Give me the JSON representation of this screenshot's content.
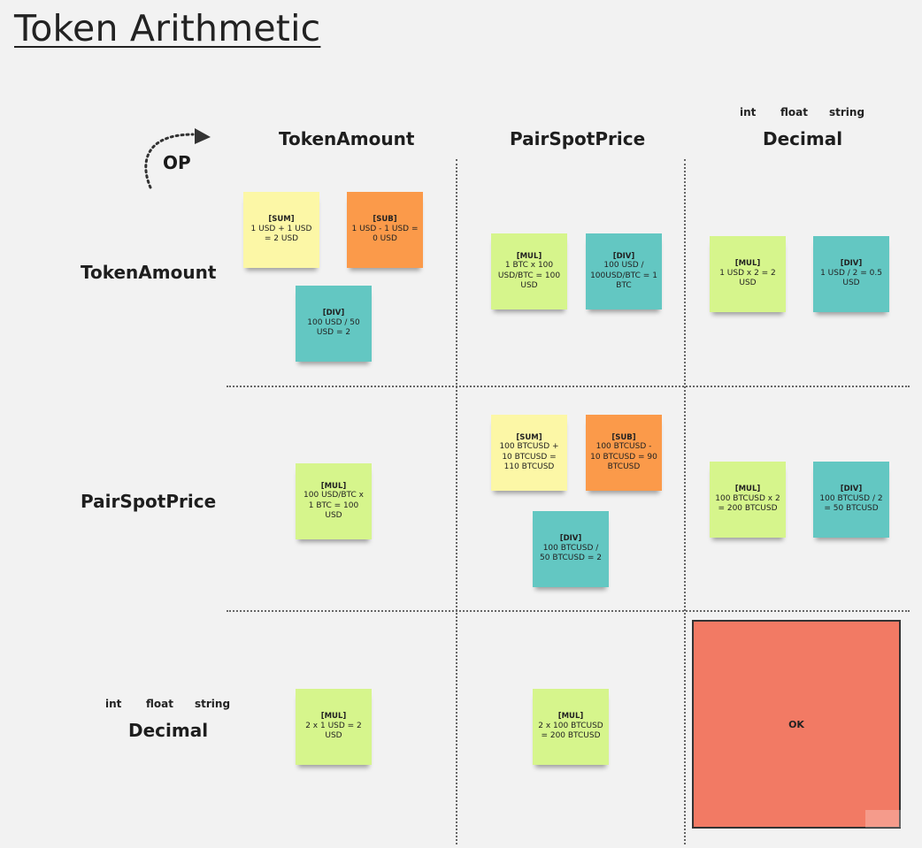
{
  "title": "Token Arithmetic",
  "op_label": "OP",
  "columns": {
    "token_amount": "TokenAmount",
    "pair_spot_price": "PairSpotPrice",
    "decimal": "Decimal",
    "decimal_types": [
      "int",
      "float",
      "string"
    ]
  },
  "rows": {
    "token_amount": "TokenAmount",
    "pair_spot_price": "PairSpotPrice",
    "decimal": "Decimal",
    "decimal_types": [
      "int",
      "float",
      "string"
    ]
  },
  "notes": {
    "ta_ta": [
      {
        "op": "[SUM]",
        "expr": "1 USD + 1 USD = 2 USD",
        "color": "#fcf7a6"
      },
      {
        "op": "[SUB]",
        "expr": "1 USD - 1 USD = 0 USD",
        "color": "#fb9a4a"
      },
      {
        "op": "[DIV]",
        "expr": "100 USD / 50 USD = 2",
        "color": "#63c7c2"
      }
    ],
    "ta_psp": [
      {
        "op": "[MUL]",
        "expr": "1 BTC x 100 USD/BTC = 100 USD",
        "color": "#d6f58c"
      },
      {
        "op": "[DIV]",
        "expr": "100 USD / 100USD/BTC = 1 BTC",
        "color": "#63c7c2"
      }
    ],
    "ta_dec": [
      {
        "op": "[MUL]",
        "expr": "1 USD x 2 = 2 USD",
        "color": "#d6f58c"
      },
      {
        "op": "[DIV]",
        "expr": "1 USD / 2 = 0.5 USD",
        "color": "#63c7c2"
      }
    ],
    "psp_ta": [
      {
        "op": "[MUL]",
        "expr": "100 USD/BTC x 1 BTC = 100 USD",
        "color": "#d6f58c"
      }
    ],
    "psp_psp": [
      {
        "op": "[SUM]",
        "expr": "100 BTCUSD + 10 BTCUSD = 110 BTCUSD",
        "color": "#fcf7a6"
      },
      {
        "op": "[SUB]",
        "expr": "100 BTCUSD - 10 BTCUSD = 90 BTCUSD",
        "color": "#fb9a4a"
      },
      {
        "op": "[DIV]",
        "expr": "100 BTCUSD / 50 BTCUSD = 2",
        "color": "#63c7c2"
      }
    ],
    "psp_dec": [
      {
        "op": "[MUL]",
        "expr": "100 BTCUSD x 2 = 200 BTCUSD",
        "color": "#d6f58c"
      },
      {
        "op": "[DIV]",
        "expr": "100 BTCUSD / 2 = 50 BTCUSD",
        "color": "#63c7c2"
      }
    ],
    "dec_ta": [
      {
        "op": "[MUL]",
        "expr": "2 x 1 USD = 2 USD",
        "color": "#d6f58c"
      }
    ],
    "dec_psp": [
      {
        "op": "[MUL]",
        "expr": "2 x 100 BTCUSD = 200 BTCUSD",
        "color": "#d6f58c"
      }
    ]
  },
  "ok_label": "OK"
}
